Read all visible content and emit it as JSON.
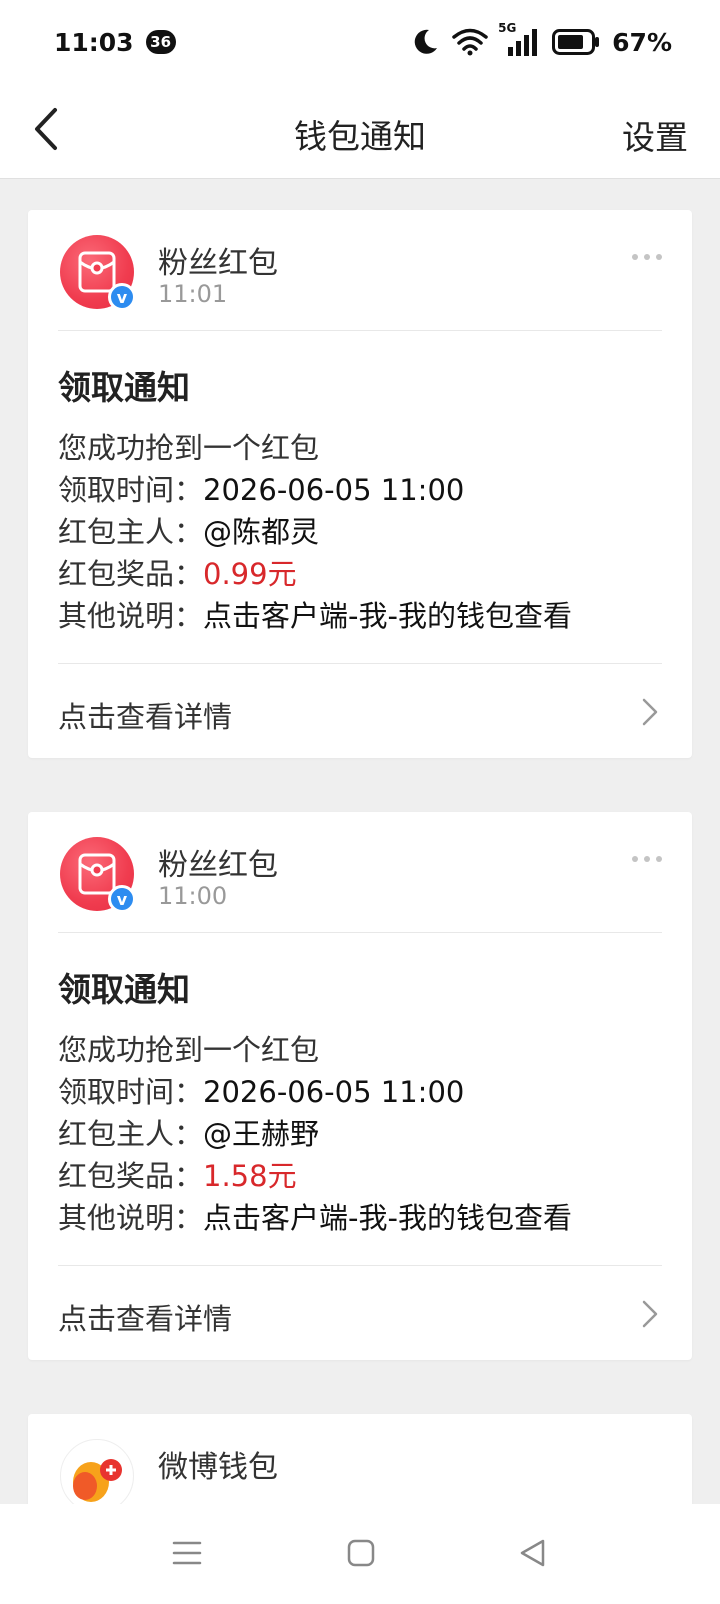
{
  "status_bar": {
    "time": "11:03",
    "badge": "36",
    "network": "5G",
    "battery_percent": "67%"
  },
  "nav": {
    "title": "钱包通知",
    "settings_label": "设置"
  },
  "cards": [
    {
      "sender": "粉丝红包",
      "time": "11:01",
      "title": "领取通知",
      "intro": "您成功抢到一个红包",
      "fields": [
        {
          "label": "领取时间：",
          "value": "2026-06-05 11:00"
        },
        {
          "label": "红包主人：",
          "value": "@陈都灵"
        },
        {
          "label": "红包奖品：",
          "value": "0.99元"
        },
        {
          "label": "其他说明：",
          "value": "点击客户端-我-我的钱包查看"
        }
      ],
      "footer": "点击查看详情"
    },
    {
      "sender": "粉丝红包",
      "time": "11:00",
      "title": "领取通知",
      "intro": "您成功抢到一个红包",
      "fields": [
        {
          "label": "领取时间：",
          "value": "2026-06-05 11:00"
        },
        {
          "label": "红包主人：",
          "value": "@王赫野"
        },
        {
          "label": "红包奖品：",
          "value": "1.58元"
        },
        {
          "label": "其他说明：",
          "value": "点击客户端-我-我的钱包查看"
        }
      ],
      "footer": "点击查看详情"
    },
    {
      "sender": "微博钱包"
    }
  ],
  "colors": {
    "accent_red": "#d8282b",
    "verified_blue": "#2d8cf0",
    "page_bg": "#efefef"
  },
  "icons": {
    "back": "chevron-left-icon",
    "more": "more-horizontal-icon",
    "footer_arrow": "chevron-right-icon",
    "bottom_nav": [
      "menu-icon",
      "home-square-icon",
      "back-triangle-icon"
    ]
  }
}
